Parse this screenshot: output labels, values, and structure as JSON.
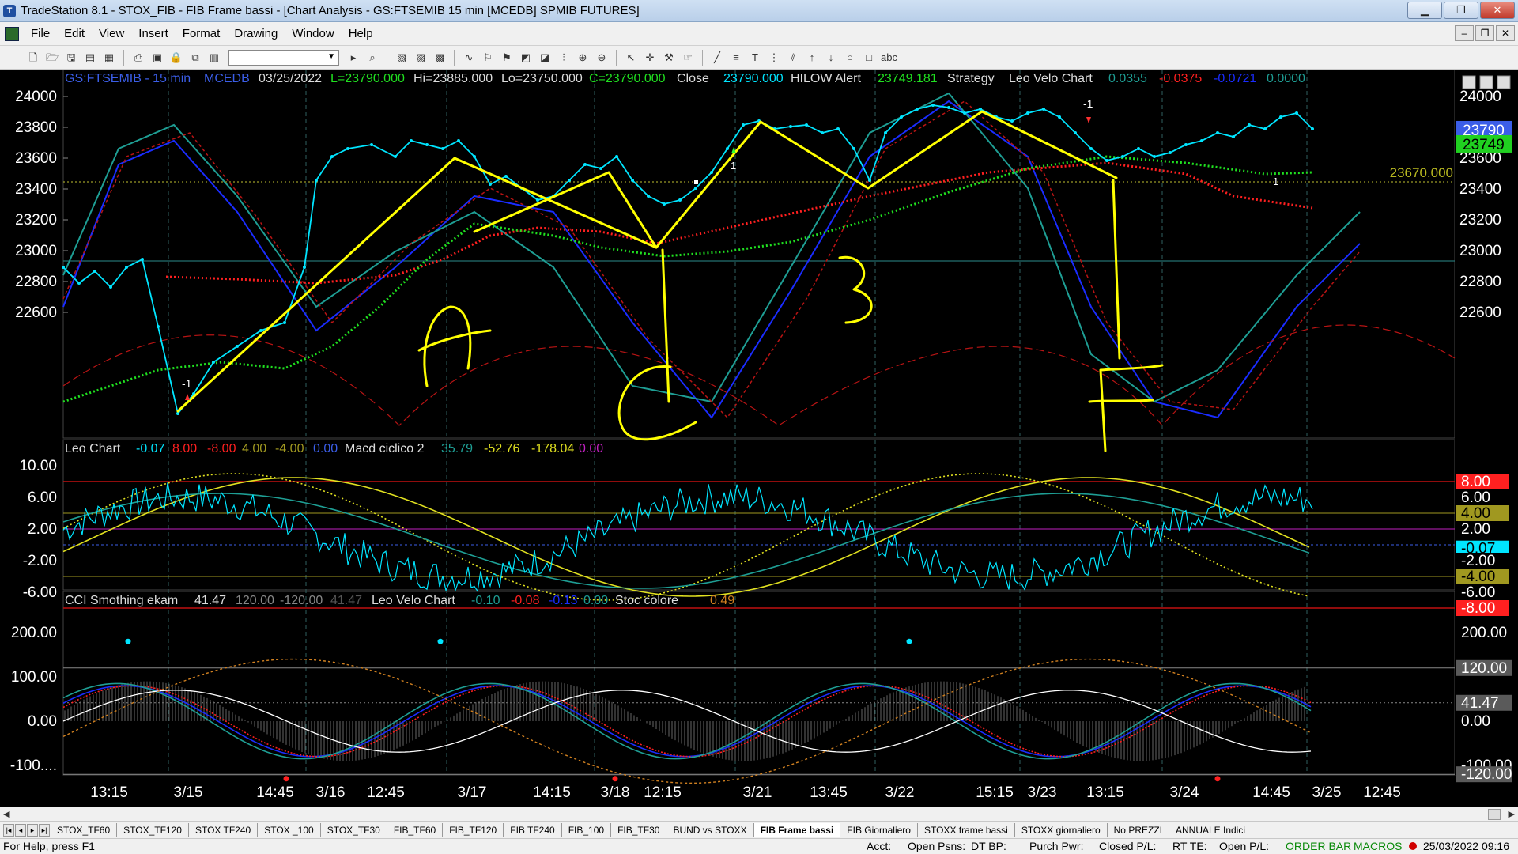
{
  "window": {
    "title": "TradeStation 8.1 - STOX_FIB - FIB Frame bassi - [Chart Analysis - GS:FTSEMIB  15 min  [MCEDB] SPMIB FUTURES]",
    "min": "▁",
    "restore": "❐",
    "close": "✕"
  },
  "menu": [
    "File",
    "Edit",
    "View",
    "Insert",
    "Format",
    "Drawing",
    "Window",
    "Help"
  ],
  "chart_header": {
    "symbol": "GS:FTSEMIB - 15 min",
    "feed": "MCEDB",
    "date": "03/25/2022",
    "last": "L=23790.000",
    "hi": "Hi=23885.000",
    "lo": "Lo=23750.000",
    "close_c": "C=23790.000",
    "close_label": "Close",
    "close_val": "23790.000",
    "hilow_label": "HILOW Alert",
    "hilow_val": "23749.181",
    "strategy": "Strategy",
    "leo_velo": "Leo Velo Chart",
    "lv1": "0.0355",
    "lv2": "-0.0375",
    "lv3": "-0.0721",
    "lv4": "0.0000"
  },
  "price_axis": [
    "24000",
    "23800",
    "23600",
    "23400",
    "23200",
    "23000",
    "22800",
    "22600"
  ],
  "price_last_tag": "23790",
  "price_second_tag": "23749",
  "price_level_label": "23670.000",
  "panel2_header": {
    "name": "Leo Chart",
    "v1": "-0.07",
    "v2": "8.00",
    "v3": "-8.00",
    "v4": "4.00",
    "v5": "-4.00",
    "v6": "0.00",
    "macd_name": "Macd ciclico 2",
    "m1": "35.79",
    "m2": "-52.76",
    "m3": "-178.04",
    "m4": "0.00"
  },
  "panel2_axis": [
    "10.00",
    "6.00",
    "2.00",
    "-2.00",
    "-6.00"
  ],
  "panel2_tags": [
    "8.00",
    "6.00",
    "4.00",
    "2.00",
    "-0.07",
    "-2.00",
    "-4.00",
    "-6.00",
    "-8.00"
  ],
  "panel3_header": {
    "name": "CCI Smothing ekam",
    "c1": "41.47",
    "c2": "120.00",
    "c3": "-120.00",
    "c4": "41.47",
    "velo_name": "Leo Velo Chart",
    "v1": "-0.10",
    "v2": "-0.08",
    "v3": "-0.13",
    "v4": "0.00",
    "stoc_name": "Stoc colore",
    "s1": "0.49"
  },
  "panel3_axis": [
    "200.00",
    "100.00",
    "0.00",
    "-100...."
  ],
  "panel3_tags": [
    "200.00",
    "120.00",
    "41.47",
    "0.00",
    "-100.00",
    "-120.00"
  ],
  "time_axis": [
    "13:15",
    "3/15",
    "14:45",
    "3/16",
    "12:45",
    "3/17",
    "14:15",
    "3/18",
    "12:15",
    "3/21",
    "13:45",
    "3/22",
    "15:15",
    "3/23",
    "13:15",
    "3/24",
    "14:45",
    "3/25",
    "12:45"
  ],
  "annotations": {
    "a": "A",
    "b": "B",
    "c": "C",
    "f": "F",
    "m1": "-1",
    "m2": "-1",
    "p1": "1",
    "p2": "1"
  },
  "tabs": [
    "STOX_TF60",
    "STOX_TF120",
    "STOX TF240",
    "STOX _100",
    "STOX_TF30",
    "FIB_TF60",
    "FIB_TF120",
    "FIB TF240",
    "FIB_100",
    "FIB_TF30",
    "BUND vs STOXX",
    "FIB Frame bassi",
    "FIB Giornaliero",
    "STOXX frame bassi",
    "STOXX giornaliero",
    "No PREZZI",
    "ANNUALE Indici"
  ],
  "active_tab": "FIB Frame bassi",
  "status": {
    "help": "For Help, press F1",
    "acct": "Acct:",
    "open_psns": "Open Psns:",
    "dt_bp": "DT BP:",
    "purch_pwr": "Purch Pwr:",
    "closed_pl": "Closed P/L:",
    "rt_te": "RT TE:",
    "open_pl": "Open P/L:",
    "order_bar": "ORDER BAR",
    "macros": "MACROS",
    "datetime": "25/03/2022 09:16"
  },
  "colors": {
    "price": "#00e5ff",
    "drawing": "#ffff00",
    "red_dots": "#ff2020",
    "green_dots": "#20e020",
    "blue_band": "#1a2cff",
    "teal_band": "#1e9e94",
    "dark_red": "#b81414"
  }
}
